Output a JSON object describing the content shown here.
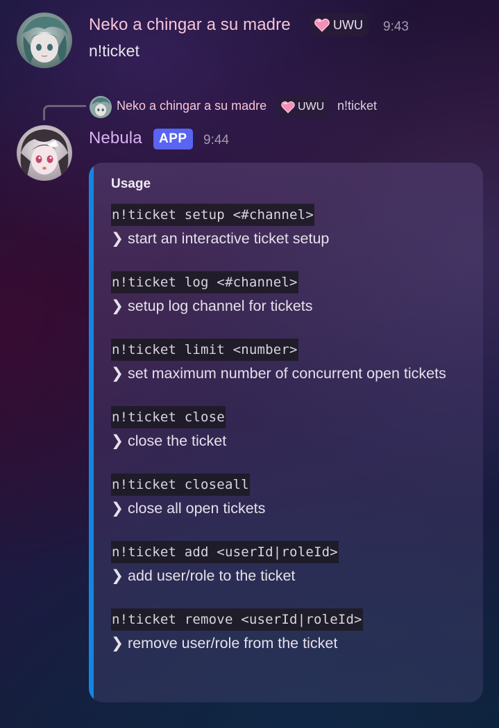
{
  "messages": [
    {
      "author": "Neko a chingar a su madre",
      "role_badge": "UWU",
      "time": "9:43",
      "content": "n!ticket"
    },
    {
      "author": "Nebula",
      "app_badge": "APP",
      "time": "9:44",
      "reply": {
        "author": "Neko a chingar a su madre",
        "role_badge": "UWU",
        "content": "n!ticket"
      },
      "embed": {
        "title": "Usage",
        "accent_color": "#1486e0",
        "items": [
          {
            "command": "n!ticket setup <#channel>",
            "description": "❯ start an interactive ticket setup"
          },
          {
            "command": "n!ticket log <#channel>",
            "description": "❯ setup log channel for tickets"
          },
          {
            "command": "n!ticket limit <number>",
            "description": "❯ set maximum number of concurrent open tickets"
          },
          {
            "command": "n!ticket close",
            "description": "❯ close the ticket"
          },
          {
            "command": "n!ticket closeall",
            "description": "❯ close all open tickets"
          },
          {
            "command": "n!ticket add <userId|roleId>",
            "description": "❯ add user/role to the ticket"
          },
          {
            "command": "n!ticket remove <userId|roleId>",
            "description": "❯ remove user/role from the ticket"
          }
        ]
      }
    }
  ],
  "colors": {
    "username_neko": "#f6c6d6",
    "username_nebula": "#d9b3f2",
    "app_badge": "#5865f2",
    "embed_accent": "#1486e0"
  },
  "icons": {
    "role_badge_icon": "pink-heart-icon"
  }
}
